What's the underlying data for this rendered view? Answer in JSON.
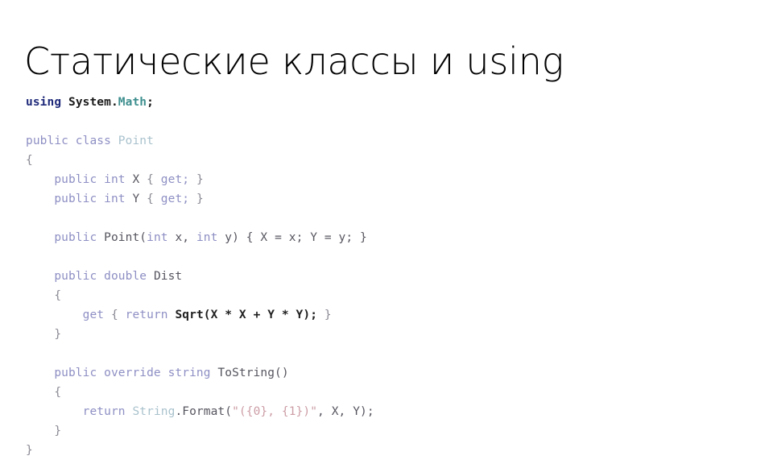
{
  "slide": {
    "title": "Статические классы и using",
    "background_color": "#ffffff",
    "title_color": "#000000"
  },
  "palette": {
    "using_keyword": "#1f2a7a",
    "namespace_plain": "#1a1a1a",
    "static_type_teal": "#3f8f8f",
    "keyword": "#8e8fc4",
    "type_name": "#a9c2cd",
    "identifier": "#55555f",
    "punctuation": "#8a8a95",
    "string_literal": "#cc9da6",
    "emphasis": "#202020"
  },
  "code": {
    "language": "C#",
    "full_text": "using System.Math;\n\npublic class Point\n{\n    public int X { get; }\n    public int Y { get; }\n\n    public Point(int x, int y) { X = x; Y = y; }\n\n    public double Dist\n    {\n        get { return Sqrt(X * X + Y * Y); }\n    }\n\n    public override string ToString()\n    {\n        return String.Format(\"({0}, {1})\", X, Y);\n    }\n}",
    "lines": [
      {
        "id": "line-using",
        "tokens": [
          {
            "t": "using",
            "c": "using_keyword"
          },
          {
            "t": " System.",
            "c": "namespace_plain"
          },
          {
            "t": "Math",
            "c": "static_type_teal"
          },
          {
            "t": ";",
            "c": "namespace_plain"
          }
        ]
      },
      {
        "id": "line-blank-1",
        "tokens": []
      },
      {
        "id": "line-class-decl",
        "tokens": [
          {
            "t": "public class ",
            "c": "keyword"
          },
          {
            "t": "Point",
            "c": "type_name"
          }
        ]
      },
      {
        "id": "line-class-open-brace",
        "tokens": [
          {
            "t": "{",
            "c": "punctuation"
          }
        ]
      },
      {
        "id": "line-prop-x",
        "tokens": [
          {
            "t": "    public int ",
            "c": "keyword"
          },
          {
            "t": "X ",
            "c": "identifier"
          },
          {
            "t": "{ ",
            "c": "punctuation"
          },
          {
            "t": "get;",
            "c": "keyword"
          },
          {
            "t": " }",
            "c": "punctuation"
          }
        ]
      },
      {
        "id": "line-prop-y",
        "tokens": [
          {
            "t": "    public int ",
            "c": "keyword"
          },
          {
            "t": "Y ",
            "c": "identifier"
          },
          {
            "t": "{ ",
            "c": "punctuation"
          },
          {
            "t": "get;",
            "c": "keyword"
          },
          {
            "t": " }",
            "c": "punctuation"
          }
        ]
      },
      {
        "id": "line-blank-2",
        "tokens": []
      },
      {
        "id": "line-ctor",
        "tokens": [
          {
            "t": "    public ",
            "c": "keyword"
          },
          {
            "t": "Point(",
            "c": "identifier"
          },
          {
            "t": "int",
            "c": "keyword"
          },
          {
            "t": " x, ",
            "c": "identifier"
          },
          {
            "t": "int",
            "c": "keyword"
          },
          {
            "t": " y) { X = x; Y = y; }",
            "c": "identifier"
          }
        ]
      },
      {
        "id": "line-blank-3",
        "tokens": []
      },
      {
        "id": "line-dist-decl",
        "tokens": [
          {
            "t": "    public double ",
            "c": "keyword"
          },
          {
            "t": "Dist",
            "c": "identifier"
          }
        ]
      },
      {
        "id": "line-dist-open-brace",
        "tokens": [
          {
            "t": "    {",
            "c": "punctuation"
          }
        ]
      },
      {
        "id": "line-dist-getter",
        "tokens": [
          {
            "t": "        get ",
            "c": "keyword"
          },
          {
            "t": "{ ",
            "c": "punctuation"
          },
          {
            "t": "return ",
            "c": "keyword"
          },
          {
            "t": "Sqrt(X * X + Y * Y);",
            "c": "emphasis"
          },
          {
            "t": " }",
            "c": "punctuation"
          }
        ]
      },
      {
        "id": "line-dist-close-brace",
        "tokens": [
          {
            "t": "    }",
            "c": "punctuation"
          }
        ]
      },
      {
        "id": "line-blank-4",
        "tokens": []
      },
      {
        "id": "line-tostring-decl",
        "tokens": [
          {
            "t": "    public override string ",
            "c": "keyword"
          },
          {
            "t": "ToString()",
            "c": "identifier"
          }
        ]
      },
      {
        "id": "line-tostring-open-brace",
        "tokens": [
          {
            "t": "    {",
            "c": "punctuation"
          }
        ]
      },
      {
        "id": "line-tostring-return",
        "tokens": [
          {
            "t": "        return ",
            "c": "keyword"
          },
          {
            "t": "String",
            "c": "type_name"
          },
          {
            "t": ".Format(",
            "c": "identifier"
          },
          {
            "t": "\"({0}, {1})\"",
            "c": "string_literal"
          },
          {
            "t": ", X, Y);",
            "c": "identifier"
          }
        ]
      },
      {
        "id": "line-tostring-close-brace",
        "tokens": [
          {
            "t": "    }",
            "c": "punctuation"
          }
        ]
      },
      {
        "id": "line-class-close-brace",
        "tokens": [
          {
            "t": "}",
            "c": "punctuation"
          }
        ]
      }
    ]
  }
}
